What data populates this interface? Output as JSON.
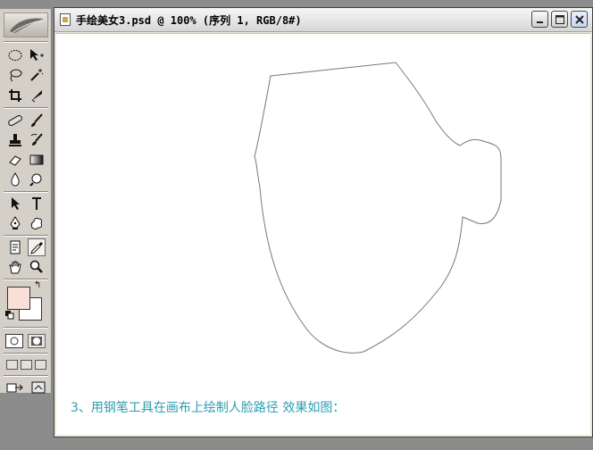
{
  "document": {
    "title": "手绘美女3.psd @ 100% (序列 1, RGB/8#)",
    "caption": "3、用钢笔工具在画布上绘制人脸路径   效果如图："
  },
  "window_controls": {
    "minimize": "_",
    "maximize": "□",
    "close": "✕"
  },
  "toolbox": {
    "foreground_color": "#f8e0d8",
    "background_color": "#ffffff",
    "tools": [
      {
        "name": "elliptical-marquee-icon",
        "glyph": "◯"
      },
      {
        "name": "move-icon",
        "glyph": "➤"
      },
      {
        "name": "lasso-icon",
        "glyph": "ℓ"
      },
      {
        "name": "magic-wand-icon",
        "glyph": "✲"
      },
      {
        "name": "crop-icon",
        "glyph": "⌗"
      },
      {
        "name": "slice-icon",
        "glyph": "⟋"
      },
      {
        "name": "healing-brush-icon",
        "glyph": "✚"
      },
      {
        "name": "brush-icon",
        "glyph": "✎"
      },
      {
        "name": "clone-stamp-icon",
        "glyph": "⚲"
      },
      {
        "name": "history-brush-icon",
        "glyph": "↺"
      },
      {
        "name": "eraser-icon",
        "glyph": "▱"
      },
      {
        "name": "gradient-icon",
        "glyph": "▭"
      },
      {
        "name": "blur-icon",
        "glyph": "💧"
      },
      {
        "name": "dodge-icon",
        "glyph": "◔"
      },
      {
        "name": "path-selection-icon",
        "glyph": "↖"
      },
      {
        "name": "type-icon",
        "glyph": "T"
      },
      {
        "name": "pen-icon",
        "glyph": "✒"
      },
      {
        "name": "custom-shape-icon",
        "glyph": "✿"
      },
      {
        "name": "notes-icon",
        "glyph": "▤"
      },
      {
        "name": "eyedropper-icon",
        "glyph": "✑"
      },
      {
        "name": "hand-icon",
        "glyph": "✋"
      },
      {
        "name": "zoom-icon",
        "glyph": "🔍"
      }
    ]
  }
}
